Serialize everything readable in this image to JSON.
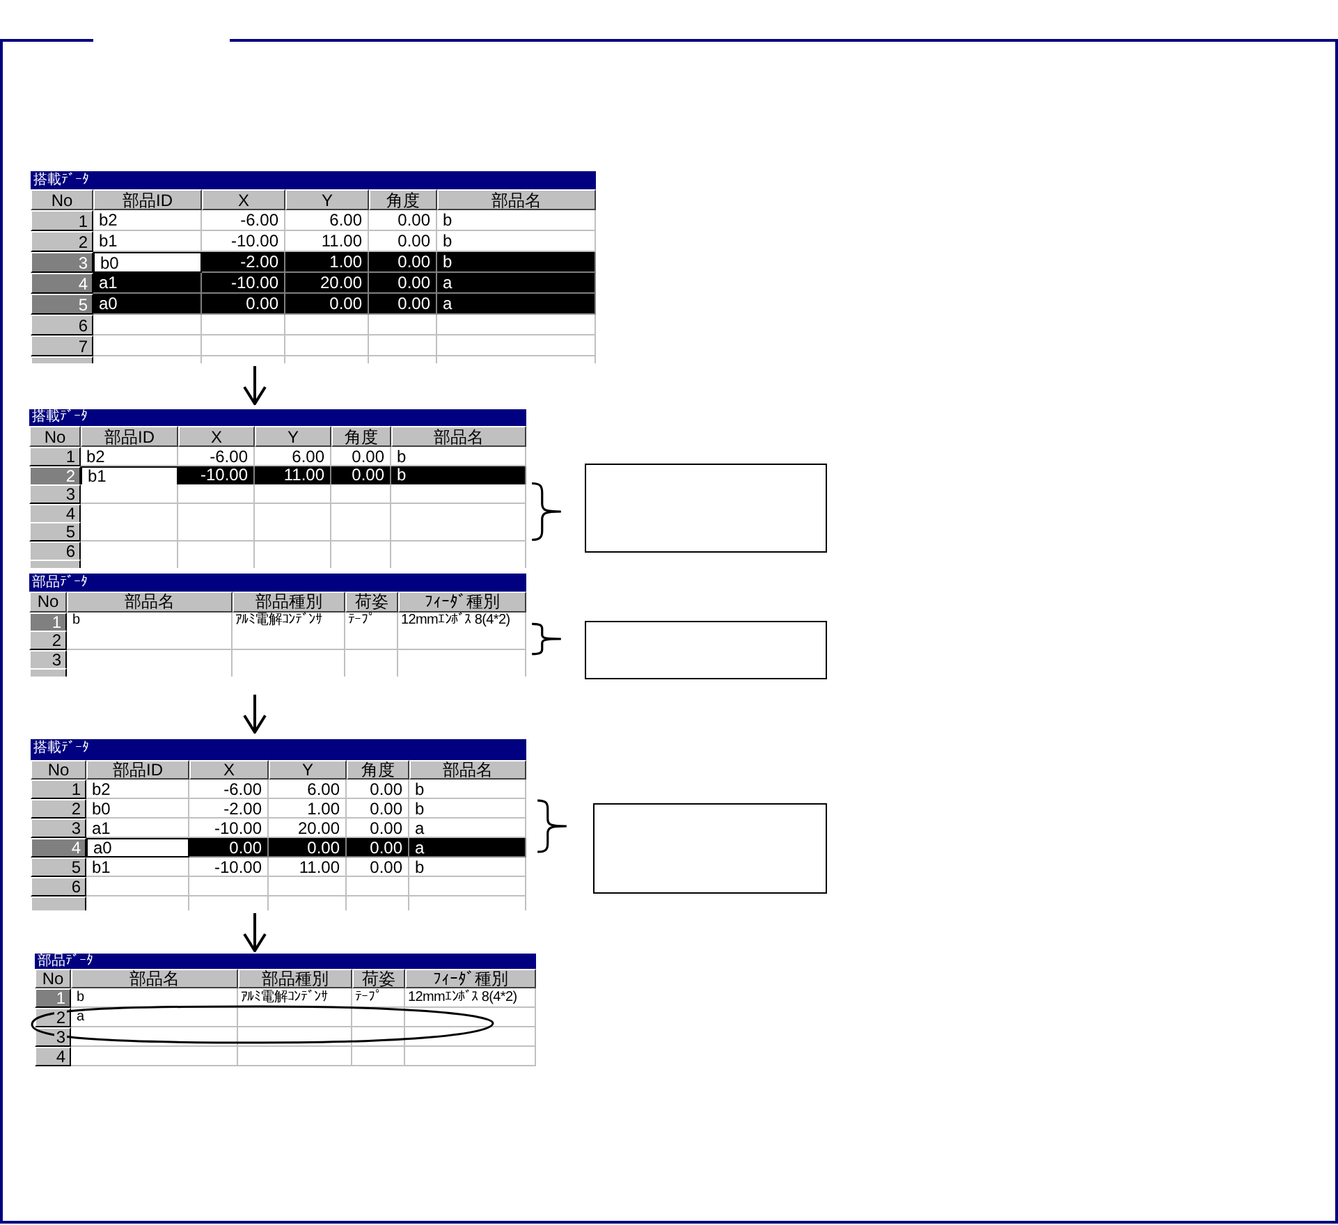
{
  "tables": [
    {
      "kind": "placement",
      "arrow_above": false,
      "note_box": false,
      "circled": false,
      "cut_off_row": true,
      "title": "搭載ﾃﾞｰﾀ",
      "columns": [
        "No",
        "部品ID",
        "X",
        "Y",
        "角度",
        "部品名"
      ],
      "rows": [
        {
          "no": "1",
          "cells": [
            "b2",
            "-6.00",
            "6.00",
            "0.00",
            "b"
          ],
          "selected": false,
          "highlighted": false,
          "cursor": false
        },
        {
          "no": "2",
          "cells": [
            "b1",
            "-10.00",
            "11.00",
            "0.00",
            "b"
          ],
          "selected": false,
          "highlighted": false,
          "cursor": false
        },
        {
          "no": "3",
          "cells": [
            "b0",
            "-2.00",
            "1.00",
            "0.00",
            "b"
          ],
          "selected": true,
          "highlighted": true,
          "cursor": true
        },
        {
          "no": "4",
          "cells": [
            "a1",
            "-10.00",
            "20.00",
            "0.00",
            "a"
          ],
          "selected": true,
          "highlighted": true,
          "cursor": false
        },
        {
          "no": "5",
          "cells": [
            "a0",
            "0.00",
            "0.00",
            "0.00",
            "a"
          ],
          "selected": true,
          "highlighted": true,
          "cursor": false
        },
        {
          "no": "6",
          "selected": false,
          "highlighted": false,
          "cursor": false
        },
        {
          "no": "7",
          "selected": false,
          "highlighted": false,
          "cursor": false
        }
      ]
    },
    {
      "kind": "placement",
      "arrow_above": true,
      "note_box": true,
      "circled": false,
      "cut_off_row": true,
      "title": "搭載ﾃﾞｰﾀ",
      "columns": [
        "No",
        "部品ID",
        "X",
        "Y",
        "角度",
        "部品名"
      ],
      "rows": [
        {
          "no": "1",
          "cells": [
            "b2",
            "-6.00",
            "6.00",
            "0.00",
            "b"
          ],
          "selected": false,
          "highlighted": false,
          "cursor": false
        },
        {
          "no": "2",
          "cells": [
            "b1",
            "-10.00",
            "11.00",
            "0.00",
            "b"
          ],
          "selected": true,
          "highlighted": true,
          "cursor": true
        },
        {
          "no": "3",
          "selected": false,
          "highlighted": false,
          "cursor": false
        },
        {
          "no": "4",
          "selected": false,
          "highlighted": false,
          "cursor": false
        },
        {
          "no": "5",
          "selected": false,
          "highlighted": false,
          "cursor": false
        },
        {
          "no": "6",
          "selected": false,
          "highlighted": false,
          "cursor": false
        }
      ]
    },
    {
      "kind": "parts",
      "arrow_above": false,
      "note_box": true,
      "circled": false,
      "cut_off_row": true,
      "title": "部品ﾃﾞｰﾀ",
      "columns": [
        "No",
        "部品名",
        "部品種別",
        "荷姿",
        "ﾌｨｰﾀﾞ種別"
      ],
      "rows": [
        {
          "no": "1",
          "cells": [
            "b",
            "ｱﾙﾐ電解ｺﾝﾃﾞﾝｻ",
            "ﾃｰﾌﾟ",
            "12mmｴﾝﾎﾞｽ 8(4*2)"
          ],
          "selected": true,
          "highlighted": false,
          "cursor": false
        },
        {
          "no": "2",
          "selected": false,
          "highlighted": false,
          "cursor": false
        },
        {
          "no": "3",
          "selected": false,
          "highlighted": false,
          "cursor": false
        }
      ]
    },
    {
      "kind": "placement",
      "arrow_above": true,
      "note_box": true,
      "circled": false,
      "cut_off_row": true,
      "title": "搭載ﾃﾞｰﾀ",
      "columns": [
        "No",
        "部品ID",
        "X",
        "Y",
        "角度",
        "部品名"
      ],
      "rows": [
        {
          "no": "1",
          "cells": [
            "b2",
            "-6.00",
            "6.00",
            "0.00",
            "b"
          ],
          "selected": false,
          "highlighted": false,
          "cursor": false
        },
        {
          "no": "2",
          "cells": [
            "b0",
            "-2.00",
            "1.00",
            "0.00",
            "b"
          ],
          "selected": false,
          "highlighted": false,
          "cursor": false
        },
        {
          "no": "3",
          "cells": [
            "a1",
            "-10.00",
            "20.00",
            "0.00",
            "a"
          ],
          "selected": false,
          "highlighted": false,
          "cursor": false
        },
        {
          "no": "4",
          "cells": [
            "a0",
            "0.00",
            "0.00",
            "0.00",
            "a"
          ],
          "selected": true,
          "highlighted": true,
          "cursor": true
        },
        {
          "no": "5",
          "cells": [
            "b1",
            "-10.00",
            "11.00",
            "0.00",
            "b"
          ],
          "selected": false,
          "highlighted": false,
          "cursor": false
        },
        {
          "no": "6",
          "selected": false,
          "highlighted": false,
          "cursor": false
        }
      ]
    },
    {
      "kind": "parts",
      "arrow_above": true,
      "note_box": false,
      "circled": true,
      "cut_off_row": false,
      "title": "部品ﾃﾞｰﾀ",
      "columns": [
        "No",
        "部品名",
        "部品種別",
        "荷姿",
        "ﾌｨｰﾀﾞ種別"
      ],
      "rows": [
        {
          "no": "1",
          "cells": [
            "b",
            "ｱﾙﾐ電解ｺﾝﾃﾞﾝｻ",
            "ﾃｰﾌﾟ",
            "12mmｴﾝﾎﾞｽ 8(4*2)"
          ],
          "selected": true,
          "highlighted": false,
          "cursor": false
        },
        {
          "no": "2",
          "cells": [
            "a"
          ],
          "selected": false,
          "highlighted": false,
          "cursor": false
        },
        {
          "no": "3",
          "selected": false,
          "highlighted": false,
          "cursor": false
        },
        {
          "no": "4",
          "selected": false,
          "highlighted": false,
          "cursor": false
        }
      ]
    }
  ]
}
